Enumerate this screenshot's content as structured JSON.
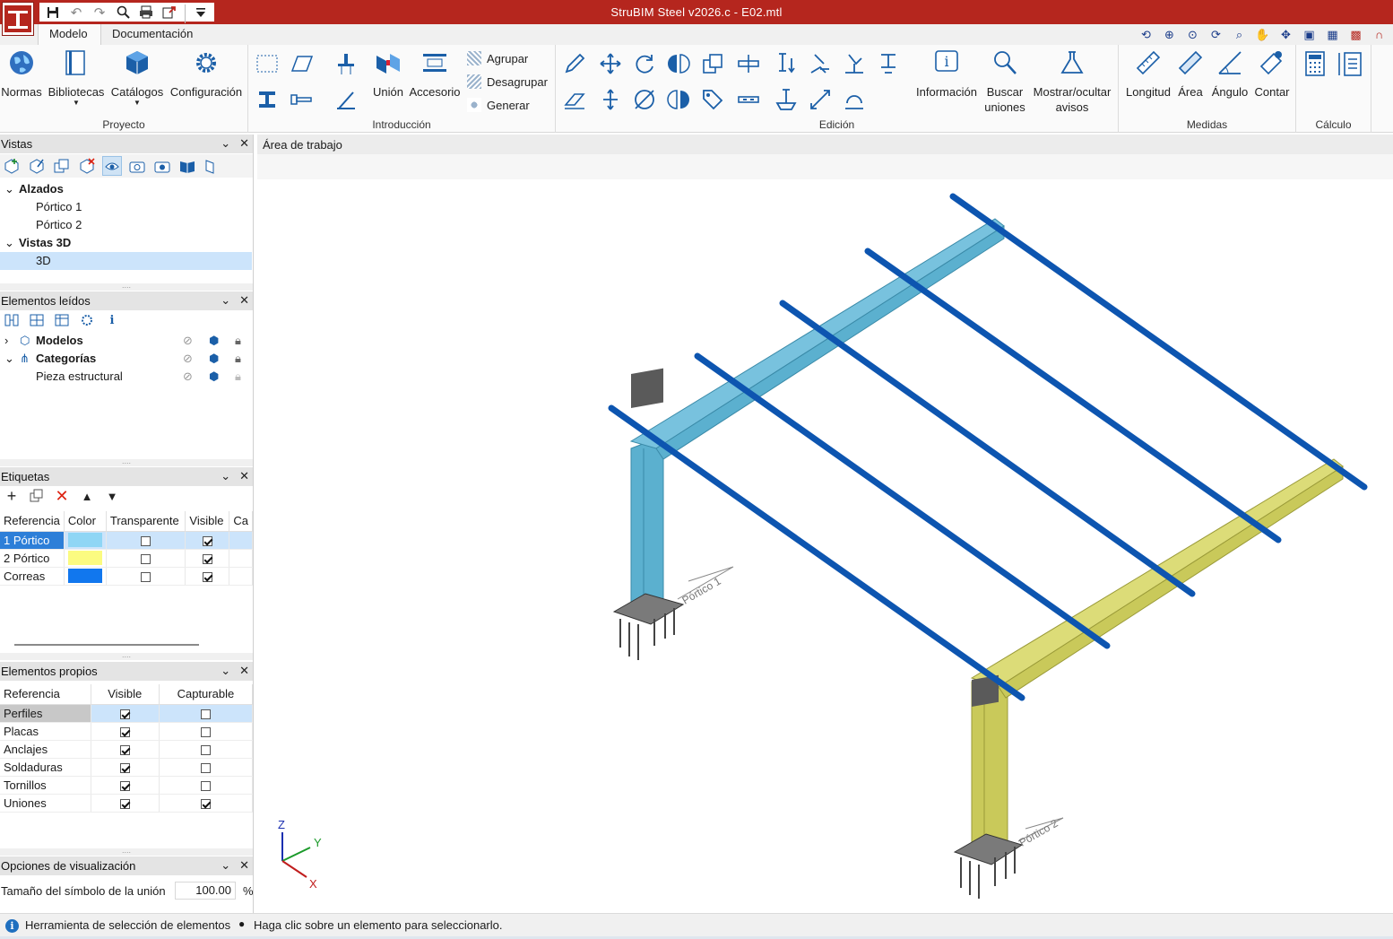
{
  "titlebar": {
    "title": "StruBIM Steel v2026.c - E02.mtl",
    "accent": "#b5261e"
  },
  "tabs": [
    {
      "label": "Modelo",
      "active": true
    },
    {
      "label": "Documentación",
      "active": false
    }
  ],
  "ribbon": {
    "proyecto": {
      "label": "Proyecto",
      "buttons": [
        "Normas",
        "Bibliotecas",
        "Catálogos",
        "Configuración"
      ]
    },
    "introduccion": {
      "label": "Introducción",
      "union": "Unión",
      "accesorio": "Accesorio",
      "agrupar": "Agrupar",
      "desagrupar": "Desagrupar",
      "generar": "Generar"
    },
    "edicion": {
      "label": "Edición",
      "informacion": "Información",
      "buscar_1": "Buscar",
      "buscar_2": "uniones",
      "mostrar_1": "Mostrar/ocultar",
      "mostrar_2": "avisos"
    },
    "medidas": {
      "label": "Medidas",
      "buttons": [
        "Longitud",
        "Área",
        "Ángulo",
        "Contar"
      ]
    },
    "calculo": {
      "label": "Cálculo"
    }
  },
  "panels": {
    "vistas": {
      "title": "Vistas",
      "groups": [
        {
          "label": "Alzados",
          "items": [
            "Pórtico 1",
            "Pórtico 2"
          ]
        },
        {
          "label": "Vistas 3D",
          "items": [
            "3D"
          ]
        }
      ]
    },
    "elementos_leidos": {
      "title": "Elementos leídos",
      "rows": [
        {
          "label": "Modelos",
          "bold": true
        },
        {
          "label": "Categorías",
          "bold": true
        },
        {
          "label": "Pieza estructural",
          "bold": false
        }
      ]
    },
    "etiquetas": {
      "title": "Etiquetas",
      "columns": [
        "Referencia",
        "Color",
        "Transparente",
        "Visible",
        "Ca"
      ],
      "rows": [
        {
          "ref": "1 Pórtico",
          "color": "#8fd6f5",
          "transparente": false,
          "visible": true
        },
        {
          "ref": "2 Pórtico",
          "color": "#fbfb80",
          "transparente": false,
          "visible": true
        },
        {
          "ref": "Correas",
          "color": "#1177ee",
          "transparente": false,
          "visible": true
        }
      ]
    },
    "elementos_propios": {
      "title": "Elementos propios",
      "columns": [
        "Referencia",
        "Visible",
        "Capturable"
      ],
      "rows": [
        {
          "ref": "Perfiles",
          "visible": true,
          "capturable": false
        },
        {
          "ref": "Placas",
          "visible": true,
          "capturable": false
        },
        {
          "ref": "Anclajes",
          "visible": true,
          "capturable": false
        },
        {
          "ref": "Soldaduras",
          "visible": true,
          "capturable": false
        },
        {
          "ref": "Tornillos",
          "visible": true,
          "capturable": false
        },
        {
          "ref": "Uniones",
          "visible": true,
          "capturable": true
        }
      ]
    },
    "opciones": {
      "title": "Opciones de visualización",
      "label": "Tamaño del símbolo de la unión",
      "value": "100.00",
      "unit": "%"
    }
  },
  "workarea": {
    "title": "Área de trabajo",
    "portico_1_label": "Pórtico 1",
    "portico_2_label": "Pórtico 2",
    "axes": {
      "z": "Z",
      "y": "Y",
      "x": "X"
    },
    "colors": {
      "portico1": "#5bb0cf",
      "portico2": "#c9c95a",
      "correas": "#0d55b0"
    }
  },
  "status": {
    "tool": "Herramienta de selección de elementos",
    "hint": "Haga clic sobre un elemento para seleccionarlo."
  }
}
